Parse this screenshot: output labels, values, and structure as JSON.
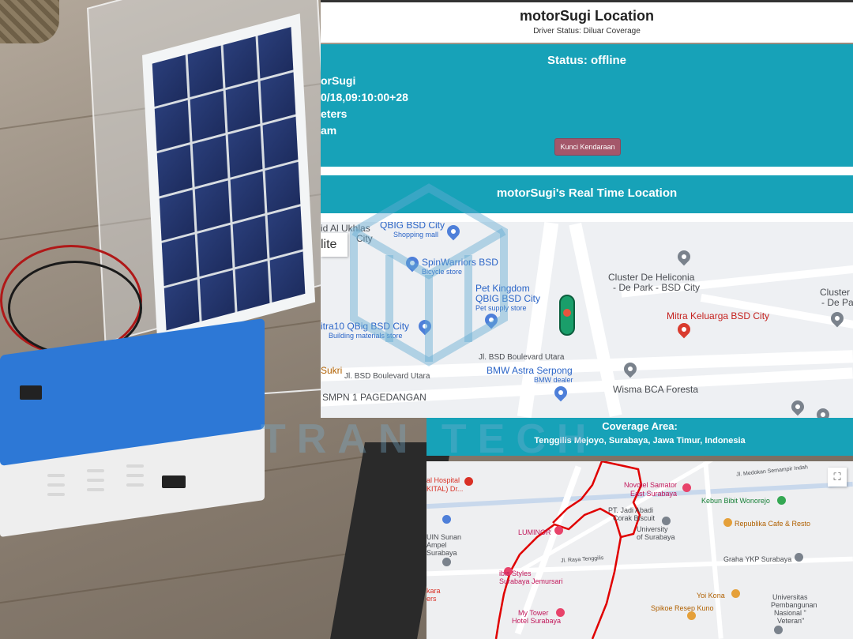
{
  "header": {
    "title": "motorSugi Location",
    "driver_status": "Driver Status: Diluar Coverage"
  },
  "status": {
    "title": "Status: offline",
    "lines": [
      "orSugi",
      "0/18,09:10:00+28",
      "eters",
      "am"
    ],
    "button_label": "Kunci Kendaraan"
  },
  "realtime": {
    "title": "motorSugi's Real Time Location"
  },
  "map1": {
    "satellite_label": "lite",
    "labels": {
      "mall_top": "id Al Ukhlas",
      "city_top": "City",
      "qbig_city": "QBIG BSD City",
      "qbig_sub": "Shopping mall",
      "spinwarriors": "SpinWarriors BSD",
      "spinwarriors_sub": "Bicycle store",
      "petkingdom": "Pet Kingdom",
      "petkingdom2": "QBIG BSD City",
      "petkingdom_sub": "Pet supply store",
      "heliconia": "Cluster De Heliconia",
      "heliconia2": "- De Park - BSD City",
      "cluster_right": "Cluster",
      "cluster_right2": "- De Pa",
      "mitra_keluarga": "Mitra Keluarga BSD City",
      "mitra10": "itra10 QBig BSD City",
      "mitra10_sub": "Building materials store",
      "jl_bsd_utara_1": "Jl. BSD Boulevard Utara",
      "jl_bsd_utara_2": "Jl. BSD Boulevard Utara",
      "bmw": "BMW Astra Serpong",
      "bmw_sub": "BMW dealer",
      "wisma": "Wisma BCA Foresta",
      "sukri": "Sukri",
      "smpn": "SMPN 1 PAGEDANGAN"
    }
  },
  "watermark": {
    "text": "TRAN TECH"
  },
  "coverage": {
    "title": "Coverage Area:",
    "location": "Tenggilis Mejoyo, Surabaya, Jawa Timur, Indonesia"
  },
  "map2": {
    "fullscreen_label": "⛶",
    "labels": {
      "hospital": "al Hospital",
      "hospital2": "KITAL) Dr...",
      "novotel": "Novotel Samator",
      "novotel2": "East Surabaya",
      "medokan": "Jl. Medokan Semampir Indah",
      "kebun": "Kebun Bibit Wonorejo",
      "jadi_abadi": "PT. Jadi Abadi",
      "jadi_abadi2": "Corak Biscuit",
      "univ_surabaya": "University",
      "univ_surabaya2": "of Surabaya",
      "republika": "Republika Cafe & Resto",
      "luminor": "LUMINOR",
      "uin": "UIN Sunan",
      "uin2": "Ampel",
      "uin3": "Surabaya",
      "jl_raya_tenggilis": "Jl. Raya Tenggilis",
      "graha_ykp": "Graha YKP Surabaya",
      "ibis": "ibis Styles",
      "ibis2": "Surabaya Jemursari",
      "yoi_kona": "Yoi Kona",
      "spikoe": "Spikoe Resep Kuno",
      "upn": "Universitas",
      "upn2": "Pembangunan",
      "upn3": "Nasional \"",
      "upn4": "Veteran\"",
      "my_tower": "My Tower",
      "my_tower2": "Hotel Surabaya",
      "kara": "kara",
      "kara2": "ers"
    }
  },
  "colors": {
    "teal": "#17a2b8",
    "button": "#a4576a",
    "boundary": "#e00000"
  }
}
